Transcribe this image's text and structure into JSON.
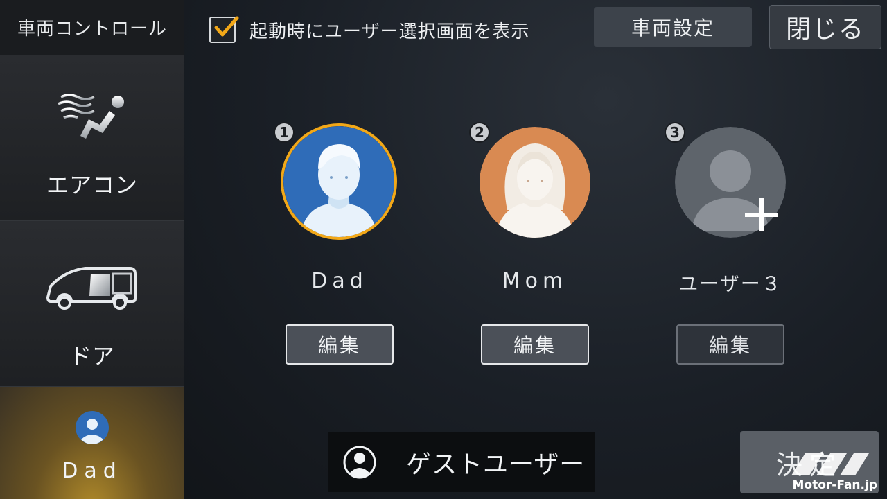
{
  "sidebar": {
    "title": "車両コントロール",
    "items": [
      {
        "label": "エアコン",
        "icon": "aircon-seat-icon"
      },
      {
        "label": "ドア",
        "icon": "sliding-door-icon"
      },
      {
        "label": "Dad",
        "icon": "user-avatar-icon"
      }
    ]
  },
  "header": {
    "checkbox_label": "起動時にユーザー選択画面を表示",
    "checkbox_checked": true,
    "vehicle_settings_label": "車両設定",
    "close_label": "閉じる"
  },
  "users": [
    {
      "number": "1",
      "name": "Dad",
      "edit_label": "編集",
      "selected": true,
      "avatar_color": "#2f6cb8"
    },
    {
      "number": "2",
      "name": "Mom",
      "edit_label": "編集",
      "selected": false,
      "avatar_color": "#d98a52"
    },
    {
      "number": "3",
      "name": "ユーザー３",
      "edit_label": "編集",
      "selected": false,
      "avatar_color": "#5e646b"
    }
  ],
  "footer": {
    "guest_label": "ゲストユーザー",
    "decide_label": "決定"
  },
  "watermark": "Motor-Fan.jp",
  "colors": {
    "accent": "#f2a818",
    "checkbox_check": "#f2a818",
    "sidebar_active": "#6a5322"
  }
}
